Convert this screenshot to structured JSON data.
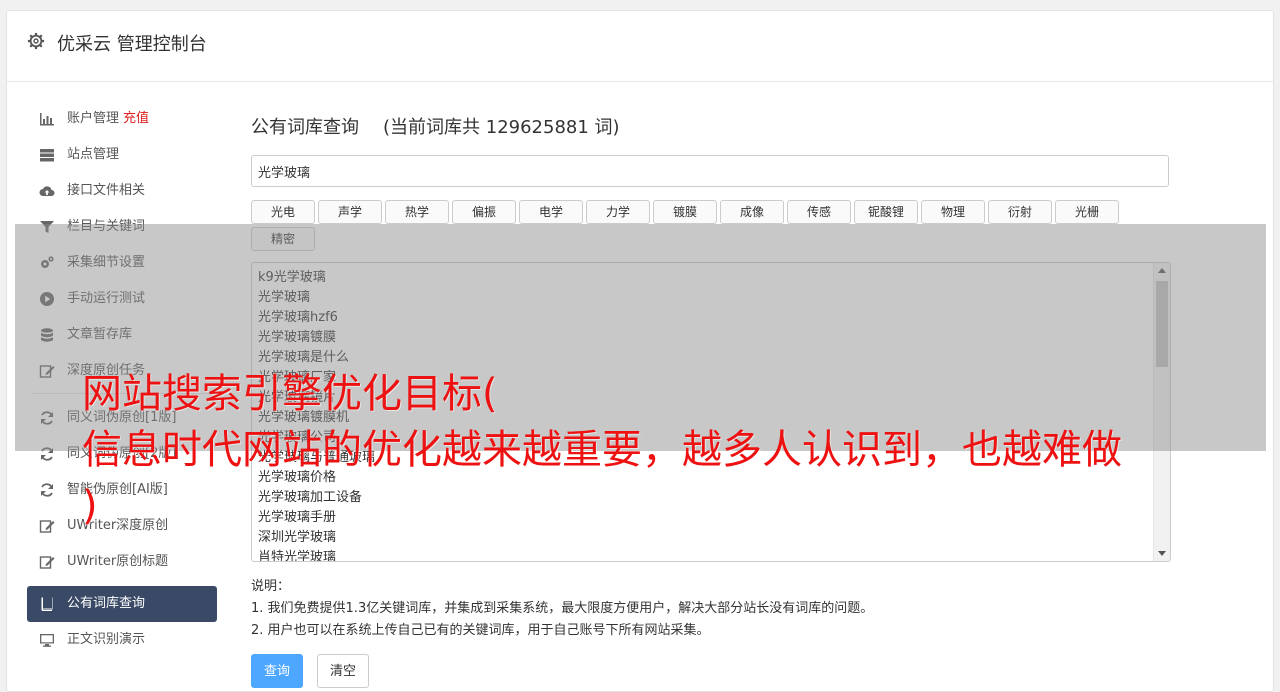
{
  "header": {
    "title": "优采云 管理控制台",
    "icon": "gear-icon"
  },
  "sidebar": {
    "items": [
      {
        "label": "账户管理",
        "badge": "充值",
        "icon": "bar-chart-icon"
      },
      {
        "label": "站点管理",
        "icon": "server-icon"
      },
      {
        "label": "接口文件相关",
        "icon": "cloud-upload-icon"
      },
      {
        "label": "栏目与关键词",
        "icon": "filter-icon"
      },
      {
        "label": "采集细节设置",
        "icon": "gears-icon"
      },
      {
        "label": "手动运行测试",
        "icon": "play-circle-icon"
      },
      {
        "label": "文章暂存库",
        "icon": "database-icon"
      },
      {
        "label": "深度原创任务",
        "icon": "edit-icon"
      },
      {
        "label": "同义词伪原创[1版]",
        "icon": "refresh-icon"
      },
      {
        "label": "同义词伪原创[2版]",
        "icon": "refresh-icon"
      },
      {
        "label": "智能伪原创[AI版]",
        "icon": "refresh-icon"
      },
      {
        "label": "UWriter深度原创",
        "icon": "edit-icon"
      },
      {
        "label": "UWriter原创标题",
        "icon": "edit-icon"
      },
      {
        "label": "公有词库查询",
        "icon": "book-icon"
      },
      {
        "label": "正文识别演示",
        "icon": "monitor-icon"
      }
    ]
  },
  "main": {
    "heading": "公有词库查询",
    "count_text": "(当前词库共 129625881 词)",
    "search_value": "光学玻璃",
    "tags": [
      "光电",
      "声学",
      "热学",
      "偏振",
      "电学",
      "力学",
      "镀膜",
      "成像",
      "传感",
      "铌酸锂",
      "物理",
      "衍射",
      "光栅",
      "精密"
    ],
    "results": [
      "k9光学玻璃",
      "光学玻璃",
      "光学玻璃hzf6",
      "光学玻璃镀膜",
      "光学玻璃是什么",
      "光学玻璃厂家",
      "光学玻璃镜片",
      "光学玻璃镀膜机",
      "光学玻璃公司",
      "光学玻璃与普通玻璃",
      "光学玻璃价格",
      "光学玻璃加工设备",
      "光学玻璃手册",
      "深圳光学玻璃",
      "肖特光学玻璃"
    ],
    "notes": {
      "title": "说明：",
      "line1": "1. 我们免费提供1.3亿关键词库，并集成到采集系统，最大限度方便用户，解决大部分站长没有词库的问题。",
      "line2": "2. 用户也可以在系统上传自己已有的关键词库，用于自己账号下所有网站采集。"
    },
    "query_button": "查询",
    "clear_button": "清空"
  },
  "overlay": {
    "line1": "网站搜索引擎优化目标(",
    "line2": "信息时代网站的优化越来越重要，越多人认识到，也越难做",
    "line3": ")"
  },
  "colors": {
    "active_nav": "#3a4a66",
    "primary": "#4da6ff",
    "recharge": "#e02020",
    "caption": "#ee1111"
  }
}
